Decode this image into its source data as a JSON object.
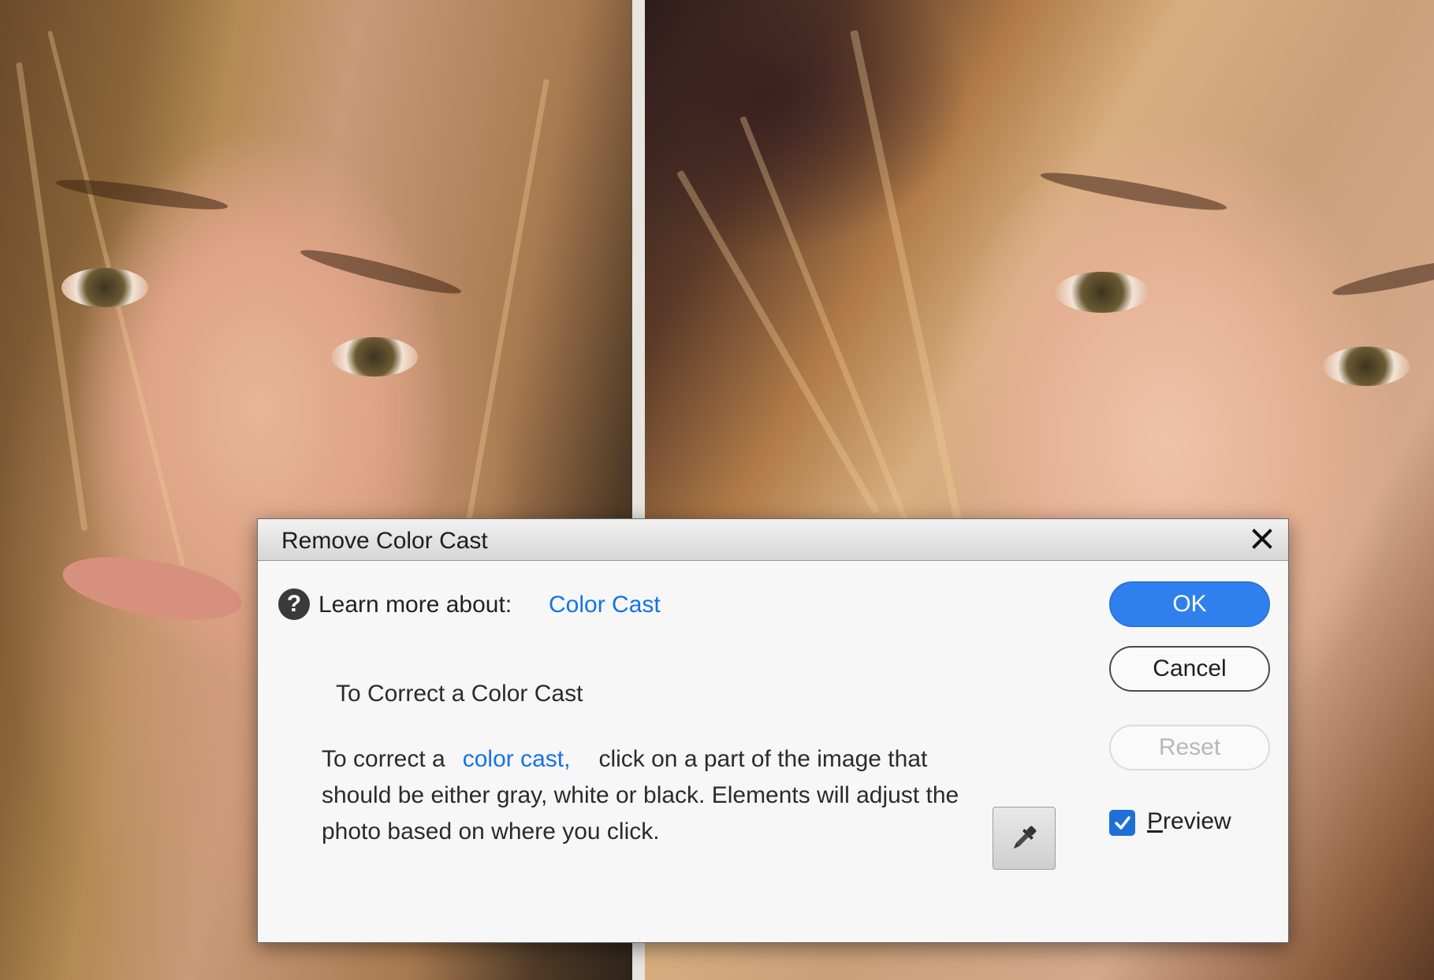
{
  "dialog": {
    "title": "Remove Color Cast",
    "learn_more_label": "Learn more about:",
    "learn_more_link": "Color Cast",
    "section_heading": "To Correct a Color Cast",
    "instructions": {
      "before_link": "To correct a",
      "link": "color cast,",
      "after_link": "click on a part of the image that should be either gray, white or black. Elements will adjust the photo based on where you click."
    },
    "buttons": {
      "ok": "OK",
      "cancel": "Cancel",
      "reset": "Reset"
    },
    "preview": {
      "mnemonic": "P",
      "rest": "review",
      "checked": true
    }
  },
  "icons": {
    "close": "close-icon",
    "help": "help-icon",
    "eyedropper": "eyedropper-icon",
    "checkmark": "checkmark-icon"
  },
  "colors": {
    "accent": "#2f80ed",
    "link": "#1473e6",
    "dialog_bg": "#f7f7f7"
  }
}
